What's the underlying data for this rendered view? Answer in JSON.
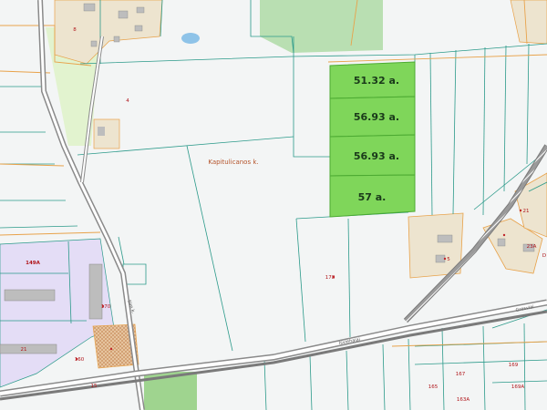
{
  "map": {
    "highlighted_lots": [
      {
        "area": "51.32 a."
      },
      {
        "area": "56.93 a."
      },
      {
        "area": "56.93 a."
      },
      {
        "area": "57 a."
      }
    ],
    "place_name": "Kapitulicanos k.",
    "street_labels": {
      "road_south": "Isviehaiai",
      "road_east": "Gresviai",
      "road_west": "Sim k."
    },
    "house_numbers": {
      "lot_178": "178",
      "lot_149a": "149A",
      "lot_170": "170",
      "lot_8": "8",
      "lot_21": "21",
      "lot_23a": "23A",
      "lot_d": "D",
      "lot_5": "5",
      "lot_167": "167",
      "lot_169": "169",
      "lot_165": "165",
      "lot_169a": "169A",
      "lot_163a": "163A",
      "lot_160": "160",
      "lot_21b": "21",
      "lot_15": "15",
      "lot_4": "4"
    },
    "colors": {
      "lot_fill": "#7fd65a",
      "parcel_line": "#2b9a8a",
      "boundary_orange": "#e8a24a",
      "railway": "#888888",
      "residential_fill": "#ece3d0",
      "industrial_fill": "#e3dcf5",
      "forest_fill": "#b7dfb0",
      "light_green": "#ddf2c6",
      "water": "#8ec3e8"
    }
  }
}
